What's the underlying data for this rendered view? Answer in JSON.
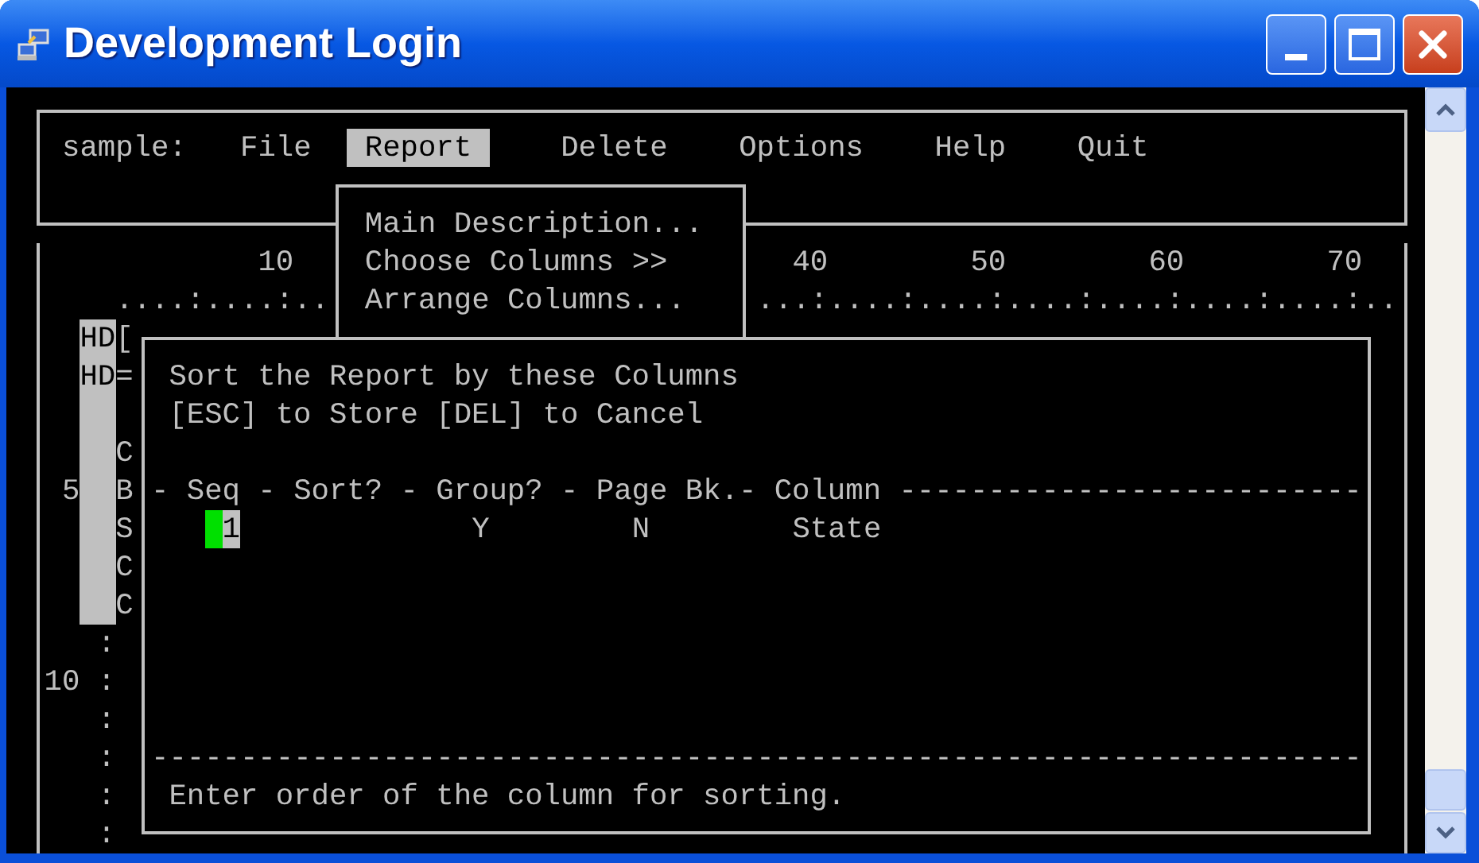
{
  "window": {
    "title": "Development Login"
  },
  "menu_bar": {
    "prefix": "sample:",
    "items": [
      {
        "label": "File",
        "selected": false
      },
      {
        "label": "Report",
        "selected": true
      },
      {
        "label": "Delete",
        "selected": false
      },
      {
        "label": "Options",
        "selected": false
      },
      {
        "label": "Help",
        "selected": false
      },
      {
        "label": "Quit",
        "selected": false
      }
    ]
  },
  "dropdown": {
    "items": [
      "Main Description...",
      "Choose Columns >>",
      "Arrange Columns..."
    ]
  },
  "ruler": {
    "labels": [
      "10",
      "40",
      "50",
      "60",
      "70"
    ],
    "dots": [
      "....:....:..",
      "...:....:....:....:....:....:....:.."
    ]
  },
  "gutter": {
    "tags": [
      "HD",
      "HD"
    ],
    "markers": [
      "[",
      "=",
      "C",
      "B",
      "S",
      "C",
      "C"
    ],
    "line_numbers": [
      "5",
      "10"
    ],
    "colons": [
      ":",
      ":",
      ":",
      ":",
      ":",
      ":"
    ]
  },
  "dialog": {
    "lines": [
      "Sort the Report by these Columns",
      "[ESC] to Store [DEL] to Cancel"
    ],
    "header": "- Seq - Sort? - Group? - Page Bk.- Column --------------------------",
    "rows": [
      {
        "seq": "1",
        "focused": true,
        "group": "Y",
        "page_break": "N",
        "column": "State"
      }
    ],
    "separator": "--------------------------------------------------------------------",
    "hint": "Enter order of the column for sorting."
  }
}
